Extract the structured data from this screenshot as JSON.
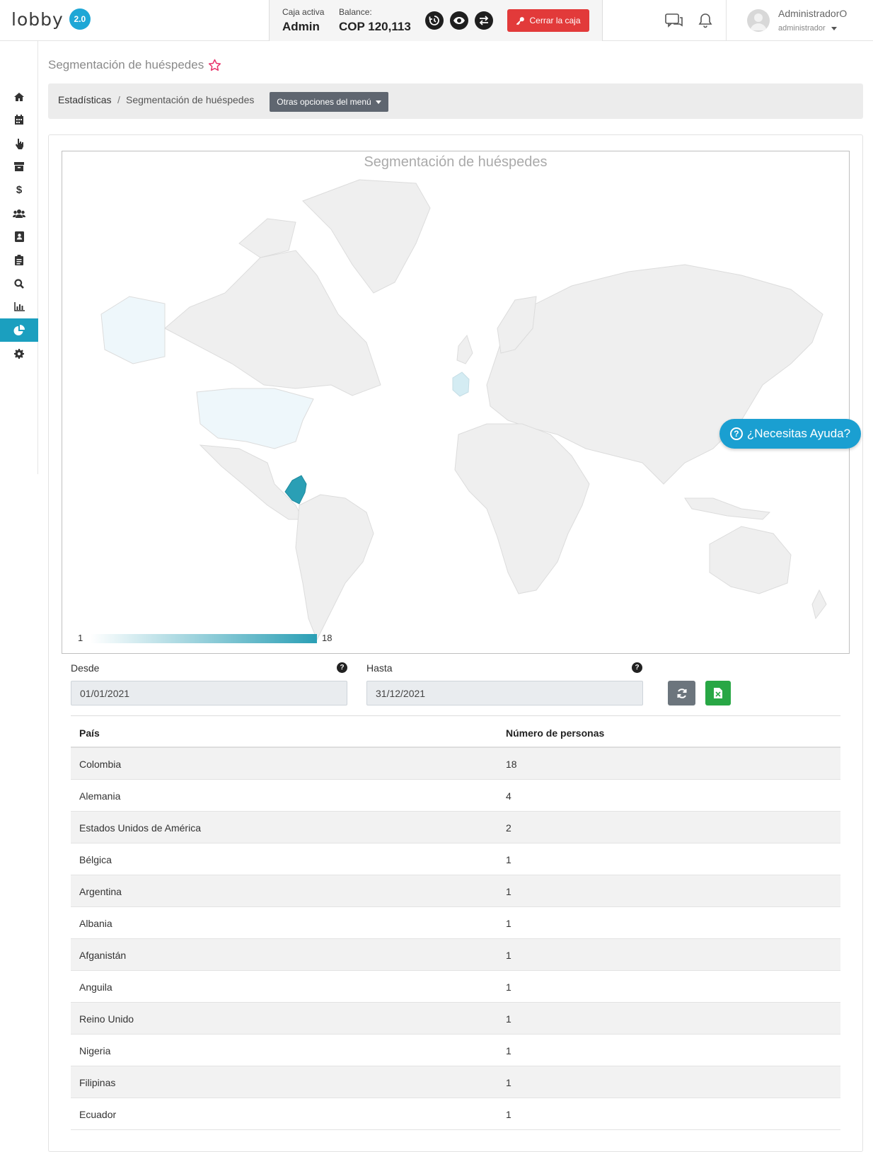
{
  "brand": {
    "logo_text": "lobby",
    "version_badge": "2.0",
    "accent": "#1ea7d6"
  },
  "cashbox": {
    "active_label": "Caja activa",
    "active_value": "Admin",
    "balance_label": "Balance:",
    "balance_value": "COP 120,113",
    "close_label": "Cerrar la caja",
    "close_color": "#e23a3a"
  },
  "user": {
    "name": "AdministradorO",
    "role": "administrador"
  },
  "sidebar": {
    "items": [
      {
        "icon": "home-icon"
      },
      {
        "icon": "calendar-icon"
      },
      {
        "icon": "hand-pointer-icon"
      },
      {
        "icon": "archive-icon"
      },
      {
        "icon": "dollar-icon"
      },
      {
        "icon": "users-icon"
      },
      {
        "icon": "contact-book-icon"
      },
      {
        "icon": "clipboard-icon"
      },
      {
        "icon": "search-icon"
      },
      {
        "icon": "bar-chart-icon"
      },
      {
        "icon": "pie-chart-icon",
        "active": true
      },
      {
        "icon": "gear-icon"
      }
    ],
    "active_color": "#1b9fbf"
  },
  "page": {
    "title": "Segmentación de huéspedes"
  },
  "breadcrumb": {
    "root": "Estadísticas",
    "separator": "/",
    "current": "Segmentación de huéspedes",
    "menu_button": "Otras opciones del menú"
  },
  "map": {
    "title": "Segmentación de huéspedes",
    "legend_min": "1",
    "legend_max": "18",
    "scale_colors": [
      "#ffffff",
      "#2a9fb5"
    ]
  },
  "help": {
    "label": "¿Necesitas Ayuda?"
  },
  "filters": {
    "from_label": "Desde",
    "from_value": "01/01/2021",
    "to_label": "Hasta",
    "to_value": "31/12/2021"
  },
  "table": {
    "headers": [
      "País",
      "Número de personas"
    ],
    "rows": [
      [
        "Colombia",
        "18"
      ],
      [
        "Alemania",
        "4"
      ],
      [
        "Estados Unidos de América",
        "2"
      ],
      [
        "Bélgica",
        "1"
      ],
      [
        "Argentina",
        "1"
      ],
      [
        "Albania",
        "1"
      ],
      [
        "Afganistán",
        "1"
      ],
      [
        "Anguila",
        "1"
      ],
      [
        "Reino Unido",
        "1"
      ],
      [
        "Nigeria",
        "1"
      ],
      [
        "Filipinas",
        "1"
      ],
      [
        "Ecuador",
        "1"
      ]
    ]
  }
}
